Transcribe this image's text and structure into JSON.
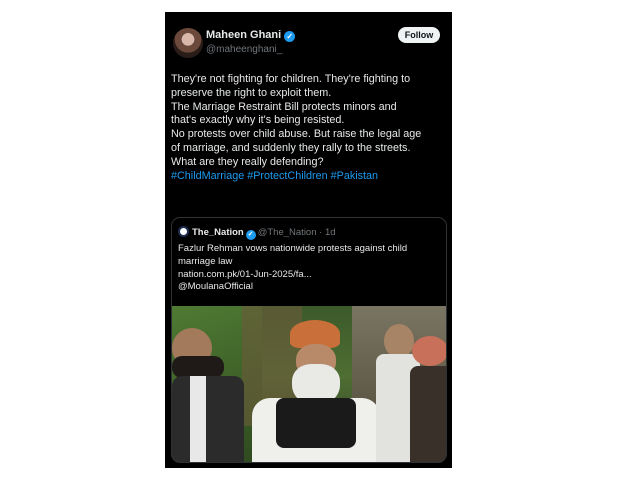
{
  "author": {
    "display_name": "Maheen Ghani",
    "handle": "@maheenghani_",
    "verified": true
  },
  "follow_label": "Follow",
  "body_lines": [
    "They're not fighting for children. They're fighting to",
    "preserve the right to exploit them.",
    "The Marriage Restraint Bill protects minors and",
    "that's exactly why it's being resisted.",
    "No protests over child abuse. But raise the legal age",
    "of marriage, and suddenly they rally to the streets.",
    "What are they really defending?"
  ],
  "hashtags": "#ChildMarriage #ProtectChildren #Pakistan",
  "quoted_post": {
    "name": "The_Nation",
    "handle": "@The_Nation",
    "separator": "·",
    "time": "1d",
    "text_lines": [
      "Fazlur Rehman vows nationwide protests against child",
      "marriage law",
      "nation.com.pk/01-Jun-2025/fa...",
      "@MoulanaOfficial"
    ]
  },
  "colors": {
    "background": "#000000",
    "text": "#e7e9ea",
    "muted": "#71767b",
    "link": "#1d9bf0",
    "verified_badge": "#1d9bf0"
  },
  "icons": {
    "verified": "verified-badge-icon"
  }
}
